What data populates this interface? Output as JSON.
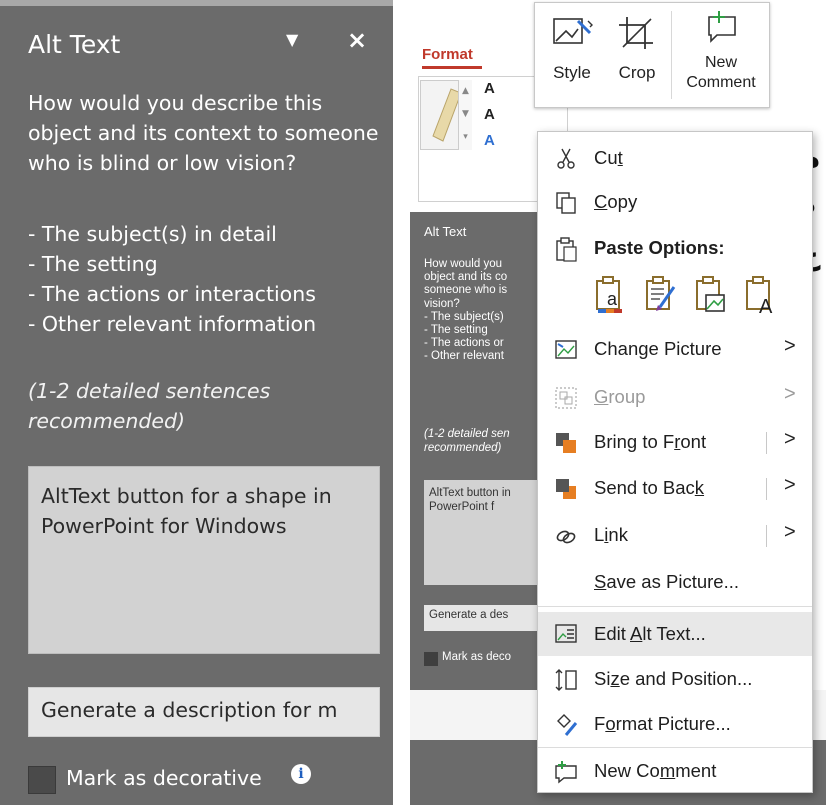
{
  "left_pane": {
    "title": "Alt Text",
    "dropdown_icon": "chevron-down-icon",
    "close_icon": "close-icon",
    "close_glyph": "×",
    "dropdown_glyph": "▼",
    "prompt": "How would you describe this object and its context to someone who is blind or low vision?",
    "list": [
      "- The subject(s) in detail",
      "- The setting",
      "- The actions or interactions",
      "- Other relevant information"
    ],
    "hint": "(1-2 detailed sentences recommended)",
    "textarea_value": "AltText button for a shape in PowerPoint for Windows",
    "generate_label": "Generate a description for m",
    "decorative_label": "Mark as decorative",
    "info_glyph": "i"
  },
  "right_screenshot": {
    "format_tab": "Format",
    "text_buttons": [
      "A",
      "A",
      "A"
    ],
    "buttons": [
      {
        "label": "Style",
        "icon": "picture-style-icon"
      },
      {
        "label": "Crop",
        "icon": "crop-icon"
      },
      {
        "label": "New\nComment",
        "label_line1": "New",
        "label_line2": "Comment",
        "icon": "new-comment-icon"
      }
    ],
    "alt_pane": {
      "title": "Alt Text",
      "text": "How would you describe this object and its context to someone who is blind or low vision?",
      "list": [
        "- The subject(s)",
        "- The setting",
        "- The actions or",
        "- Other relevant"
      ],
      "text_lines": [
        "How would you",
        "object and its co",
        "someone who is",
        "vision?"
      ],
      "hint": "(1-2 detailed sen recommended)",
      "box_value": "AltText button in PowerPoint f",
      "generate_label": "Generate a des",
      "decorative_label": "Mark as deco"
    },
    "arabic_chars": [
      "م",
      "ة",
      "ع",
      ":"
    ]
  },
  "context_menu": {
    "items": [
      {
        "key": "cut",
        "label_pre": "Cu",
        "label_u": "t",
        "label_post": "",
        "icon": "scissors-icon"
      },
      {
        "key": "copy",
        "label_pre": "",
        "label_u": "C",
        "label_post": "opy",
        "icon": "copy-icon"
      },
      {
        "key": "paste",
        "label": "Paste Options:",
        "icon": "clipboard-icon"
      },
      {
        "key": "change_picture",
        "label_pre": "Chan",
        "label_u": "g",
        "label_post": "e Picture",
        "icon": "change-picture-icon",
        "submenu": true
      },
      {
        "key": "group",
        "label_pre": "",
        "label_u": "G",
        "label_post": "roup",
        "icon": "group-icon",
        "submenu": true,
        "disabled": true
      },
      {
        "key": "bring_front",
        "label_pre": "Bring to F",
        "label_u": "r",
        "label_post": "ont",
        "icon": "bring-to-front-icon",
        "submenu": true
      },
      {
        "key": "send_back",
        "label_pre": "Send to Bac",
        "label_u": "k",
        "label_post": "",
        "icon": "send-to-back-icon",
        "submenu": true
      },
      {
        "key": "link",
        "label_pre": "L",
        "label_u": "i",
        "label_post": "nk",
        "icon": "link-icon",
        "submenu": true
      },
      {
        "key": "save_picture",
        "label_pre": "",
        "label_u": "S",
        "label_post": "ave as Picture...",
        "icon": ""
      },
      {
        "key": "edit_alt",
        "label_pre": "Edit ",
        "label_u": "A",
        "label_post": "lt Text...",
        "icon": "edit-alt-text-icon",
        "highlighted": true
      },
      {
        "key": "size_position",
        "label_pre": "Si",
        "label_u": "z",
        "label_post": "e and Position...",
        "icon": "size-position-icon"
      },
      {
        "key": "format_picture",
        "label_pre": "F",
        "label_u": "o",
        "label_post": "rmat Picture...",
        "icon": "format-picture-icon"
      },
      {
        "key": "new_comment",
        "label_pre": "New Co",
        "label_u": "m",
        "label_post": "ment",
        "icon": "new-comment-icon"
      }
    ],
    "paste_options": [
      {
        "icon": "paste-keep-source-icon"
      },
      {
        "icon": "paste-brush-icon"
      },
      {
        "icon": "paste-picture-icon"
      },
      {
        "icon": "paste-text-only-icon"
      }
    ],
    "arrow_glyph": ">"
  }
}
